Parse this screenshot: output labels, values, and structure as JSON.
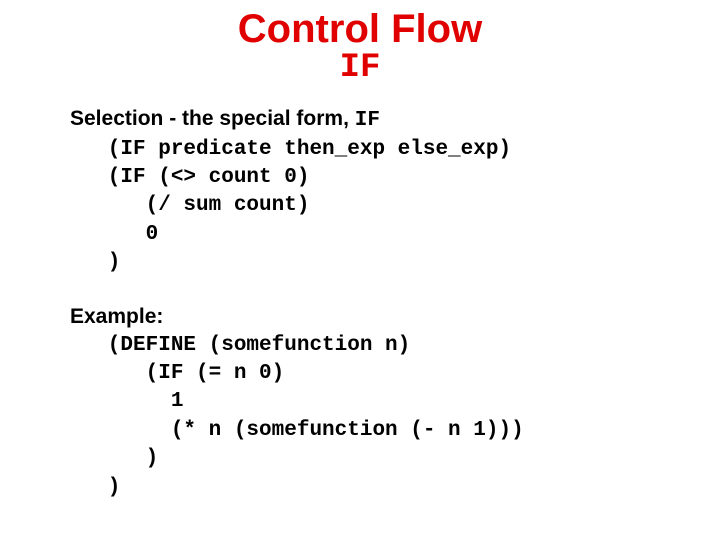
{
  "title": "Control Flow",
  "subtitle": "IF",
  "section1": {
    "heading_prefix": "Selection - the special form, ",
    "heading_code": "IF",
    "code_l1": "   (IF predicate then_exp else_exp)",
    "code_l2": "   (IF (<> count 0)",
    "code_l3": "      (/ sum count)",
    "code_l4": "      0",
    "code_l5": "   )"
  },
  "section2": {
    "heading": "Example:",
    "code_l1": "   (DEFINE (somefunction n)",
    "code_l2": "      (IF (= n 0)",
    "code_l3": "        1",
    "code_l4": "        (* n (somefunction (- n 1)))",
    "code_l5": "      )",
    "code_l6": "   )"
  }
}
